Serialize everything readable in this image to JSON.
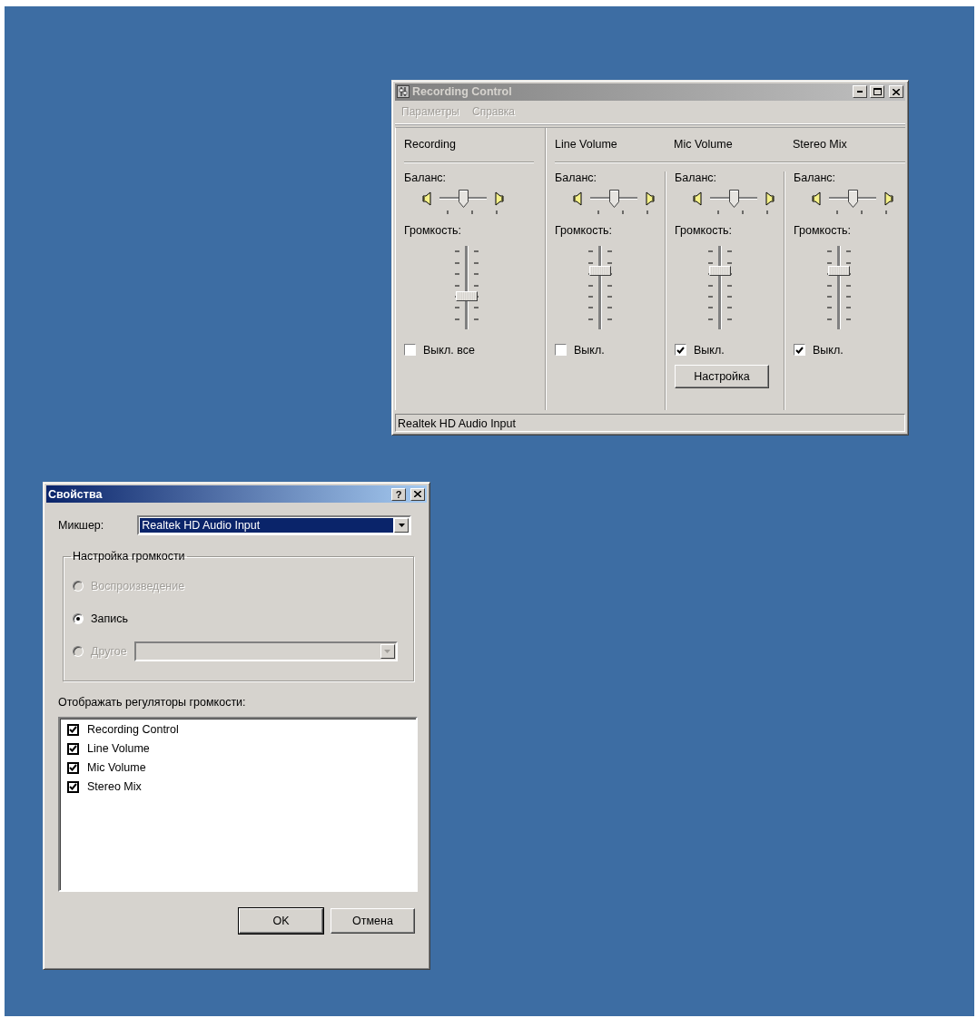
{
  "recording_window": {
    "title": "Recording Control",
    "active": false,
    "menu": [
      "Параметры",
      "Справка"
    ],
    "columns": [
      {
        "title": "Recording",
        "balance": {
          "label": "Баланс:",
          "level": 0.5
        },
        "volume": {
          "label": "Громкость:",
          "level": 0.38
        },
        "mute": {
          "label": "Выкл. все",
          "checked": false
        }
      },
      {
        "title": "Line Volume",
        "balance": {
          "label": "Баланс:",
          "level": 0.5
        },
        "volume": {
          "label": "Громкость:",
          "level": 0.73
        },
        "mute": {
          "label": "Выкл.",
          "checked": false
        }
      },
      {
        "title": "Mic Volume",
        "balance": {
          "label": "Баланс:",
          "level": 0.5
        },
        "volume": {
          "label": "Громкость:",
          "level": 0.73
        },
        "mute": {
          "label": "Выкл.",
          "checked": true
        },
        "button": "Настройка"
      },
      {
        "title": "Stereo Mix",
        "balance": {
          "label": "Баланс:",
          "level": 0.5
        },
        "volume": {
          "label": "Громкость:",
          "level": 0.73
        },
        "mute": {
          "label": "Выкл.",
          "checked": true
        }
      }
    ],
    "status_bar": "Realtek HD Audio Input"
  },
  "properties_dialog": {
    "title": "Свойства",
    "active": true,
    "help_button": "?",
    "mixer": {
      "label": "Микшер:",
      "value": "Realtek HD Audio Input"
    },
    "volume_group": {
      "title": "Настройка громкости",
      "options": [
        {
          "label": "Воспроизведение",
          "selected": false,
          "disabled": true
        },
        {
          "label": "Запись",
          "selected": true,
          "disabled": false
        },
        {
          "label": "Другое",
          "selected": false,
          "disabled": true,
          "kind": "combo"
        }
      ]
    },
    "controls_label": "Отображать регуляторы громкости:",
    "controls": [
      {
        "label": "Recording Control",
        "checked": true
      },
      {
        "label": "Line Volume",
        "checked": true
      },
      {
        "label": "Mic Volume",
        "checked": true
      },
      {
        "label": "Stereo Mix",
        "checked": true
      }
    ],
    "buttons": [
      {
        "label": "OK",
        "default": true
      },
      {
        "label": "Отмена",
        "default": false
      }
    ]
  }
}
